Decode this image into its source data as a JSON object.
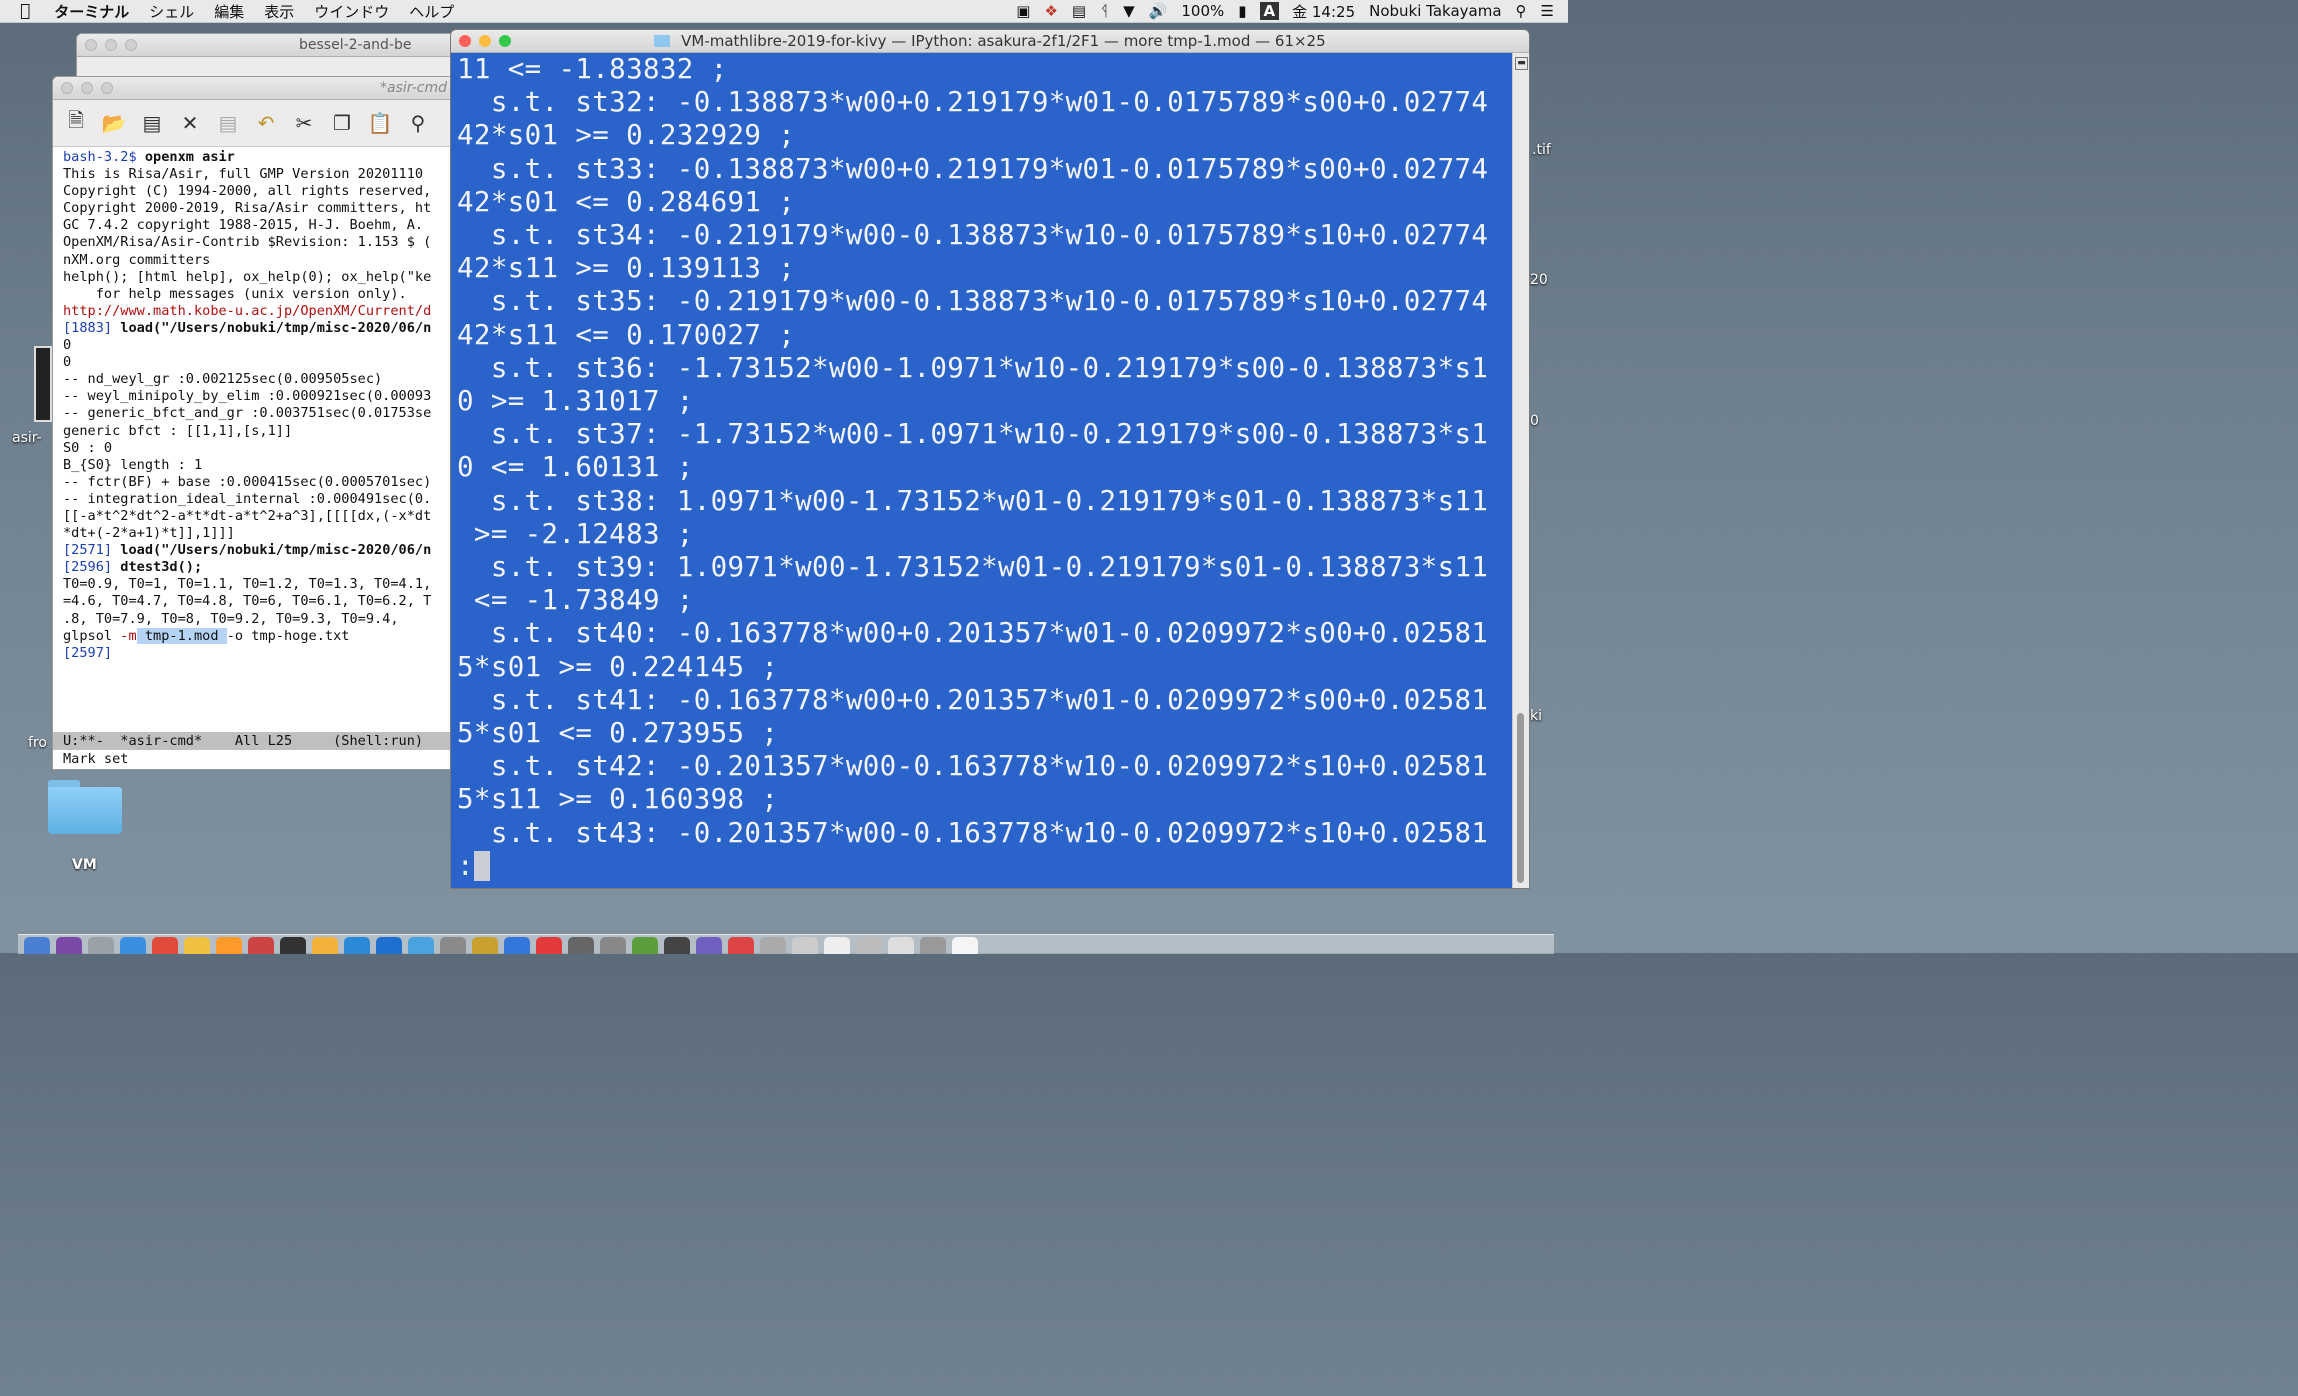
{
  "menubar": {
    "apple": "",
    "app": "ターミナル",
    "items": [
      "シェル",
      "編集",
      "表示",
      "ウインドウ",
      "ヘルプ"
    ],
    "battery": "100%",
    "input_method": "A",
    "clock": "金 14:25",
    "user": "Nobuki Takayama"
  },
  "back_window": {
    "title": "bessel-2-and-be"
  },
  "asir_window": {
    "title": "*asir-cmd",
    "modeline": "U:**-  *asir-cmd*    All L25     (Shell:run)",
    "minibuffer": "Mark set",
    "lines": [
      {
        "t": "bash-3.2$ ",
        "c": "blue",
        "rest": "openxm asir",
        "rc": "b"
      },
      {
        "t": "This is Risa/Asir, full GMP Version 20201110"
      },
      {
        "t": "Copyright (C) 1994-2000, all rights reserved,"
      },
      {
        "t": "Copyright 2000-2019, Risa/Asir committers, ht"
      },
      {
        "t": "GC 7.4.2 copyright 1988-2015, H-J. Boehm, A."
      },
      {
        "t": "OpenXM/Risa/Asir-Contrib $Revision: 1.153 $ ("
      },
      {
        "t": "nXM.org committers"
      },
      {
        "t": "helph(); [html help], ox_help(0); ox_help(\"ke"
      },
      {
        "t": "    for help messages (unix version only)."
      },
      {
        "t": "http://www.math.kobe-u.ac.jp/OpenXM/Current/d",
        "c": "red"
      },
      {
        "t": "[1883] ",
        "c": "blue",
        "rest": "load(\"/Users/nobuki/tmp/misc-2020/06/n",
        "rc": "b"
      },
      {
        "t": "0"
      },
      {
        "t": "0"
      },
      {
        "t": "-- nd_weyl_gr :0.002125sec(0.009505sec)"
      },
      {
        "t": "-- weyl_minipoly_by_elim :0.000921sec(0.00093"
      },
      {
        "t": "-- generic_bfct_and_gr :0.003751sec(0.01753se"
      },
      {
        "t": "generic bfct : [[1,1],[s,1]]"
      },
      {
        "t": "S0 : 0"
      },
      {
        "t": "B_{S0} length : 1"
      },
      {
        "t": "-- fctr(BF) + base :0.000415sec(0.0005701sec)"
      },
      {
        "t": "-- integration_ideal_internal :0.000491sec(0."
      },
      {
        "t": "[[-a*t^2*dt^2-a*t*dt-a*t^2+a^3],[[[[dx,(-x*dt"
      },
      {
        "t": "*dt+(-2*a+1)*t]],1]]]"
      },
      {
        "t": "[2571] ",
        "c": "blue",
        "rest": "load(\"/Users/nobuki/tmp/misc-2020/06/n",
        "rc": "b"
      },
      {
        "t": "[2596] ",
        "c": "blue",
        "rest": "dtest3d();",
        "rc": "b"
      },
      {
        "t": "T0=0.9, T0=1, T0=1.1, T0=1.2, T0=1.3, T0=4.1,"
      },
      {
        "t": "=4.6, T0=4.7, T0=4.8, T0=6, T0=6.1, T0=6.2, T"
      },
      {
        "t": ".8, T0=7.9, T0=8, T0=9.2, T0=9.3, T0=9.4,"
      },
      {
        "t": "glpsol ",
        "rest": "-m",
        "rc": "red",
        "sel": " tmp-1.mod ",
        "after": "-o tmp-hoge.txt"
      },
      {
        "t": "[2597]",
        "c": "blue"
      }
    ]
  },
  "terminal": {
    "title": "VM-mathlibre-2019-for-kivy — IPython: asakura-2f1/2F1 — more tmp-1.mod — 61×25",
    "lines": [
      "11 <= -1.83832 ;",
      "  s.t. st32: -0.138873*w00+0.219179*w01-0.0175789*s00+0.02774",
      "42*s01 >= 0.232929 ;",
      "  s.t. st33: -0.138873*w00+0.219179*w01-0.0175789*s00+0.02774",
      "42*s01 <= 0.284691 ;",
      "  s.t. st34: -0.219179*w00-0.138873*w10-0.0175789*s10+0.02774",
      "42*s11 >= 0.139113 ;",
      "  s.t. st35: -0.219179*w00-0.138873*w10-0.0175789*s10+0.02774",
      "42*s11 <= 0.170027 ;",
      "  s.t. st36: -1.73152*w00-1.0971*w10-0.219179*s00-0.138873*s1",
      "0 >= 1.31017 ;",
      "  s.t. st37: -1.73152*w00-1.0971*w10-0.219179*s00-0.138873*s1",
      "0 <= 1.60131 ;",
      "  s.t. st38: 1.0971*w00-1.73152*w01-0.219179*s01-0.138873*s11",
      " >= -2.12483 ;",
      "  s.t. st39: 1.0971*w00-1.73152*w01-0.219179*s01-0.138873*s11",
      " <= -1.73849 ;",
      "  s.t. st40: -0.163778*w00+0.201357*w01-0.0209972*s00+0.02581",
      "5*s01 >= 0.224145 ;",
      "  s.t. st41: -0.163778*w00+0.201357*w01-0.0209972*s00+0.02581",
      "5*s01 <= 0.273955 ;",
      "  s.t. st42: -0.201357*w00-0.163778*w10-0.0209972*s10+0.02581",
      "5*s11 >= 0.160398 ;",
      "  s.t. st43: -0.201357*w00-0.163778*w10-0.0209972*s10+0.02581"
    ],
    "prompt": ":"
  },
  "desktop": {
    "folder_label": "VM",
    "partial_labels": [
      "asir-",
      ".tif",
      "20",
      "0",
      "fro",
      "ki"
    ]
  },
  "colors": {
    "terminal_bg": "#2a63c9",
    "terminal_fg": "#f2f4f8",
    "prompt_blue": "#1a3fb3",
    "url_red": "#b01010",
    "close": "#fc605b",
    "minimize": "#fdbc40",
    "zoom": "#34c84a"
  },
  "icons": {
    "toolbar": [
      "new-file-icon",
      "open-folder-icon",
      "save-icon",
      "close-x-icon",
      "save-disabled-icon",
      "undo-icon",
      "cut-icon",
      "copy-icon",
      "paste-icon",
      "search-doc-icon"
    ]
  }
}
